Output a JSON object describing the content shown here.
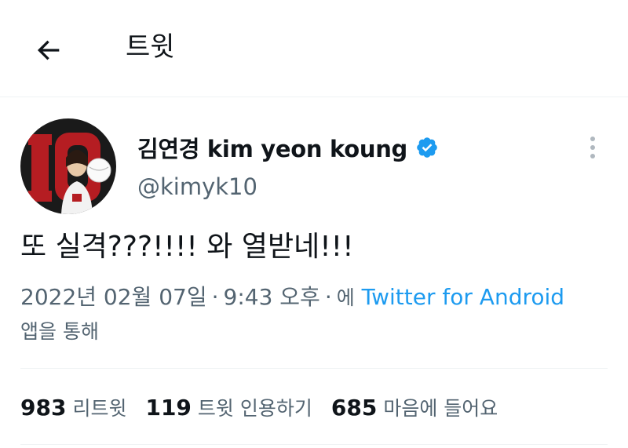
{
  "header": {
    "title": "트윗",
    "back_icon": "arrow-left-icon"
  },
  "author": {
    "display_name": "김연경 kim yeon koung",
    "handle": "@kimyk10",
    "verified": true,
    "avatar_jersey_number": "10",
    "colors": {
      "verified": "#1d9bf0",
      "avatar_bg": "#1a1a1a",
      "jersey_red": "#b51d22"
    }
  },
  "tweet": {
    "text": "또 실격???!!!! 와 열받네!!!",
    "date": "2022년 02월 07일",
    "time": "9:43 오후",
    "source_prefix": "에",
    "source": "Twitter for Android",
    "source_suffix": "앱을 통해"
  },
  "stats": {
    "retweets": {
      "count": "983",
      "label": "리트윗"
    },
    "quotes": {
      "count": "119",
      "label": "트윗 인용하기"
    },
    "likes": {
      "count": "685",
      "label": "마음에 들어요"
    }
  },
  "colors": {
    "text": "#0f1419",
    "secondary": "#536471",
    "link": "#1d9bf0",
    "divider": "#eff3f4"
  }
}
